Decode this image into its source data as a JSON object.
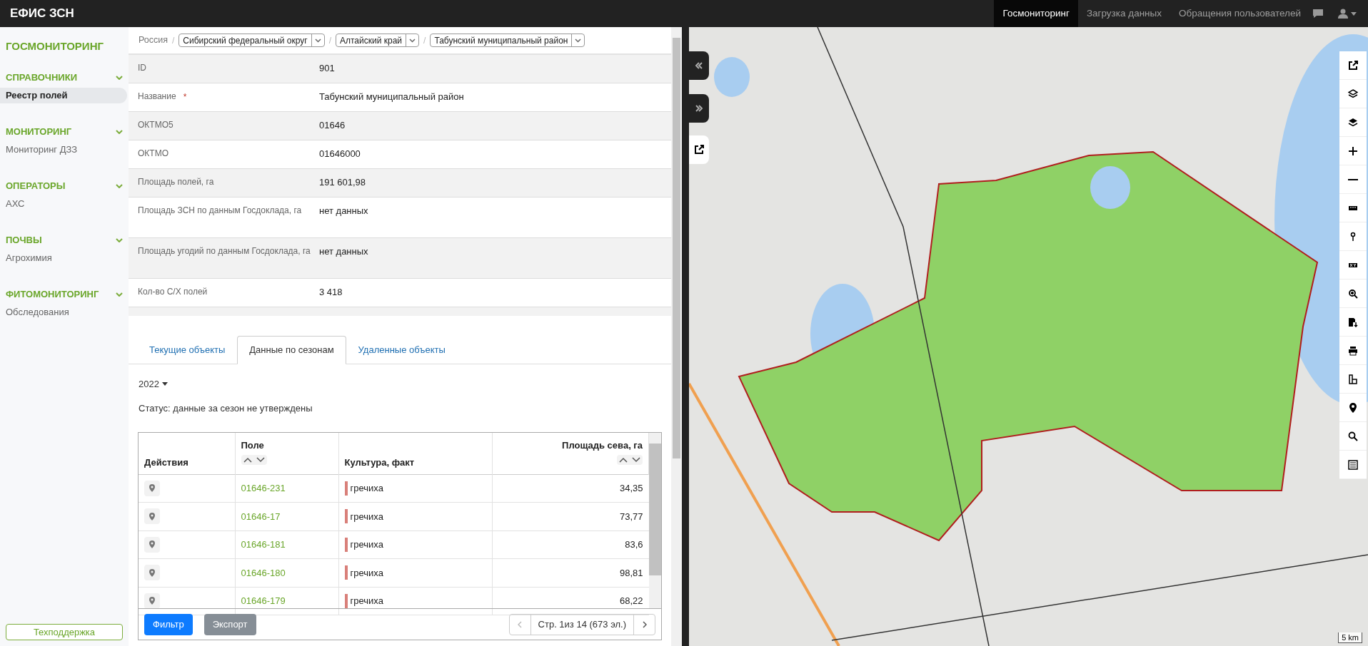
{
  "app_title": "ЕФИС ЗСН",
  "top_nav": [
    {
      "label": "Госмониторинг",
      "selected": true
    },
    {
      "label": "Загрузка данных",
      "selected": false
    },
    {
      "label": "Обращения пользователей",
      "selected": false
    }
  ],
  "sidebar": {
    "title": "ГОСМОНИТОРИНГ",
    "sections": [
      {
        "label": "СПРАВОЧНИКИ",
        "expanded": true,
        "items": [
          {
            "label": "Реестр полей",
            "selected": true
          }
        ]
      },
      {
        "label": "МОНИТОРИНГ",
        "expanded": true,
        "items": [
          {
            "label": "Мониторинг ДЗЗ",
            "selected": false
          }
        ]
      },
      {
        "label": "ОПЕРАТОРЫ",
        "expanded": true,
        "items": [
          {
            "label": "АХС",
            "selected": false
          }
        ]
      },
      {
        "label": "ПОЧВЫ",
        "expanded": true,
        "items": [
          {
            "label": "Агрохимия",
            "selected": false
          }
        ]
      },
      {
        "label": "ФИТОМОНИТОРИНГ",
        "expanded": true,
        "items": [
          {
            "label": "Обследования",
            "selected": false
          }
        ]
      }
    ],
    "support_button": "Техподдержка"
  },
  "breadcrumb": {
    "root": "Россия",
    "separators": [
      "/",
      "/",
      "/"
    ],
    "selects": [
      "Сибирский федеральный округ",
      "Алтайский край",
      "Табунский муниципальный район"
    ]
  },
  "details": [
    {
      "label": "ID",
      "value": "901",
      "required": false
    },
    {
      "label": "Название",
      "value": "Табунский муниципальный район",
      "required": true
    },
    {
      "label": "ОКТМО5",
      "value": "01646",
      "required": false
    },
    {
      "label": "ОКТМО",
      "value": "01646000",
      "required": false
    },
    {
      "label": "Площадь полей, га",
      "value": "191 601,98",
      "required": false
    },
    {
      "label": "Площадь ЗСН по данным Госдоклада, га",
      "value": "нет данных",
      "required": false
    },
    {
      "label": "Площадь угодий по данным Госдоклада, га",
      "value": "нет данных",
      "required": false
    },
    {
      "label": "Кол-во С/Х полей",
      "value": "3 418",
      "required": false
    }
  ],
  "required_mark": "*",
  "tabs": [
    {
      "label": "Текущие объекты",
      "selected": false
    },
    {
      "label": "Данные по сезонам",
      "selected": true
    },
    {
      "label": "Удаленные объекты",
      "selected": false
    }
  ],
  "season": "2022",
  "status": "Статус: данные за сезон не утверждены",
  "table": {
    "columns": [
      "Действия",
      "Поле",
      "Культура, факт",
      "Площадь сева, га"
    ],
    "rows": [
      {
        "field": "01646-231",
        "crop": "гречиха",
        "color": "#d9807a",
        "area": "34,35"
      },
      {
        "field": "01646-17",
        "crop": "гречиха",
        "color": "#d9807a",
        "area": "73,77"
      },
      {
        "field": "01646-181",
        "crop": "гречиха",
        "color": "#d9807a",
        "area": "83,6"
      },
      {
        "field": "01646-180",
        "crop": "гречиха",
        "color": "#d9807a",
        "area": "98,81"
      },
      {
        "field": "01646-179",
        "crop": "гречиха",
        "color": "#d9807a",
        "area": "68,22"
      }
    ]
  },
  "filter_button": "Фильтр",
  "export_button": "Экспорт",
  "pagination": "Стр. 1из 14 (673 эл.)",
  "map": {
    "scale": "5 km"
  }
}
